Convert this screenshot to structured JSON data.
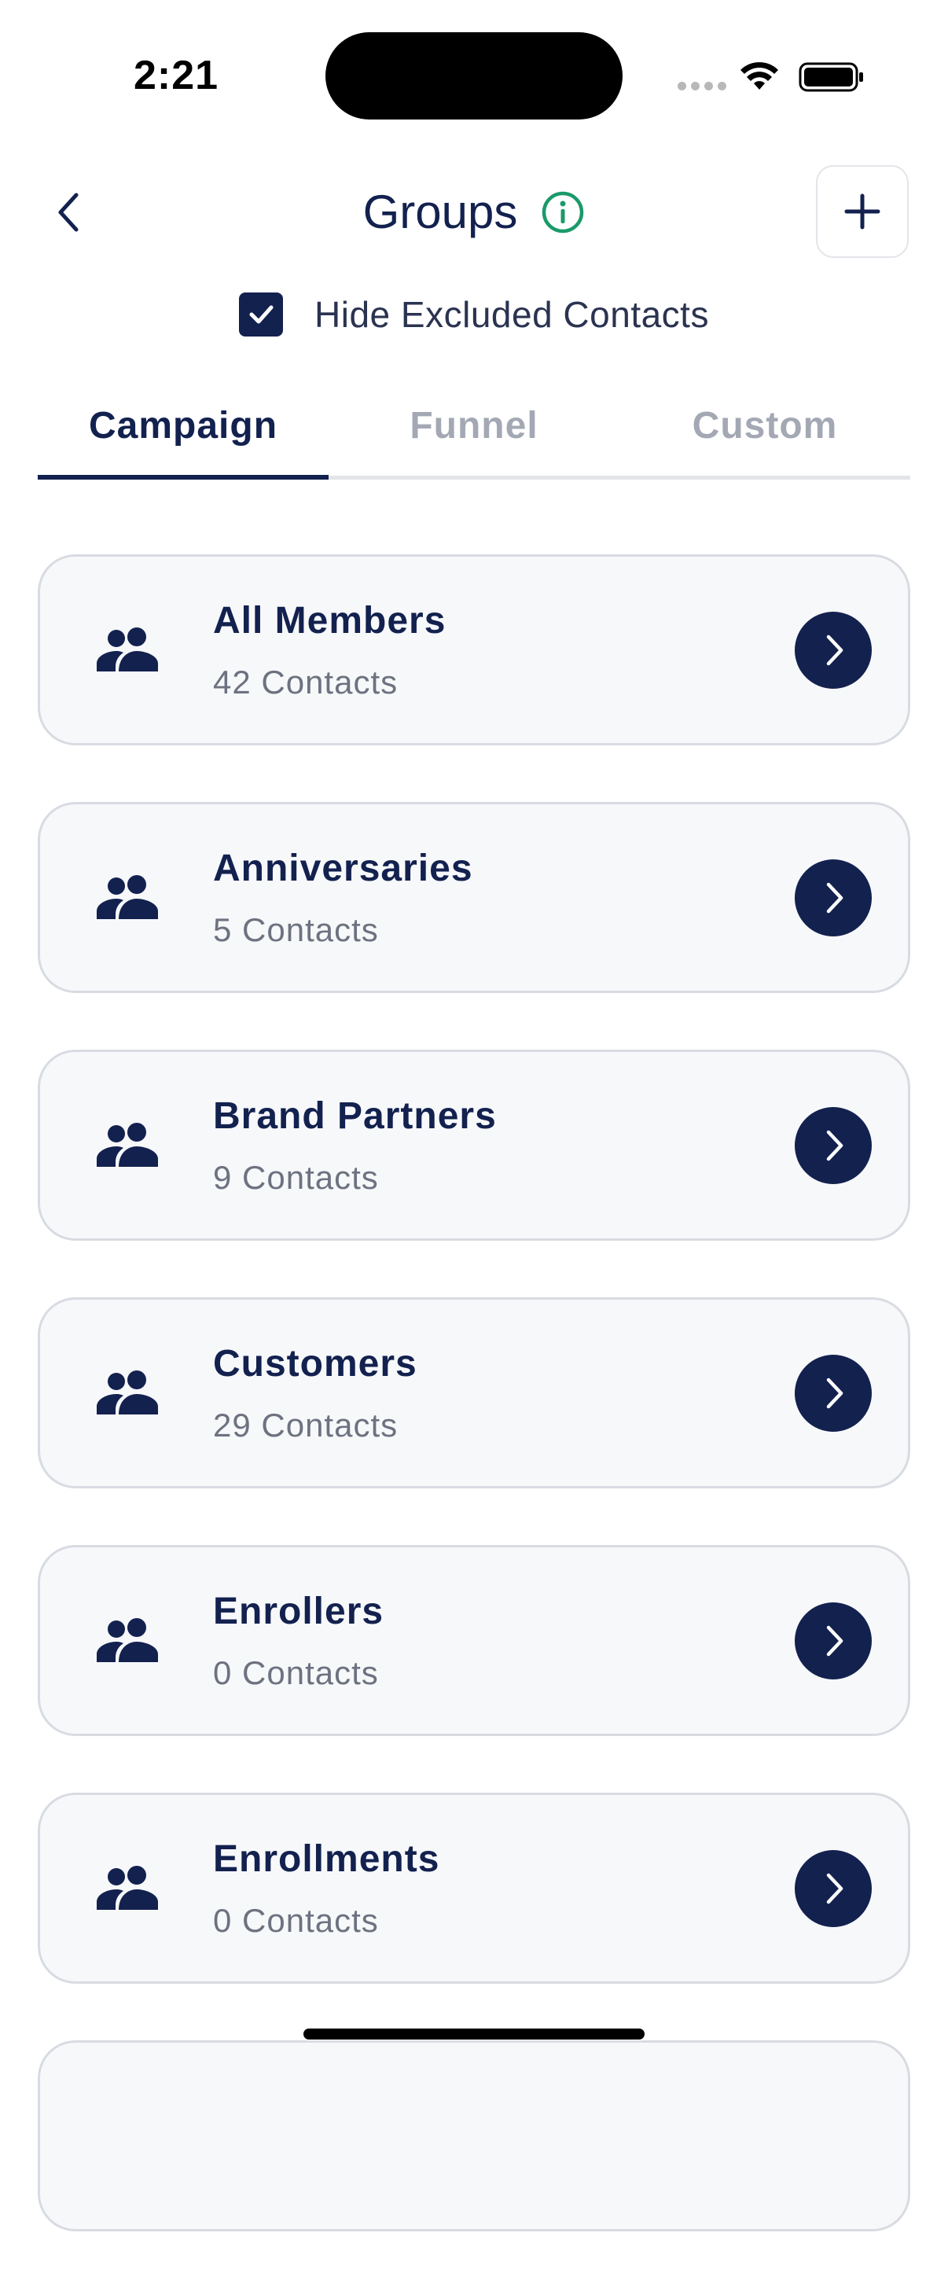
{
  "status_bar": {
    "time": "2:21"
  },
  "header": {
    "title": "Groups",
    "back_icon": "chevron-left-icon",
    "info_icon": "info-icon",
    "add_icon": "plus-icon"
  },
  "filter": {
    "hide_excluded_label": "Hide Excluded Contacts",
    "hide_excluded_checked": true
  },
  "tabs": [
    {
      "label": "Campaign",
      "active": true
    },
    {
      "label": "Funnel",
      "active": false
    },
    {
      "label": "Custom",
      "active": false
    }
  ],
  "groups": [
    {
      "name": "All Members",
      "count": "42 Contacts"
    },
    {
      "name": "Anniversaries",
      "count": "5 Contacts"
    },
    {
      "name": "Brand Partners",
      "count": "9 Contacts"
    },
    {
      "name": "Customers",
      "count": "29 Contacts"
    },
    {
      "name": "Enrollers",
      "count": "0 Contacts"
    },
    {
      "name": "Enrollments",
      "count": "0 Contacts"
    }
  ],
  "colors": {
    "primary": "#13214f",
    "info_green": "#1a9a6a",
    "card_bg": "#f7f8fa",
    "card_border": "#d8dbe1",
    "muted_text": "#6d7280"
  }
}
